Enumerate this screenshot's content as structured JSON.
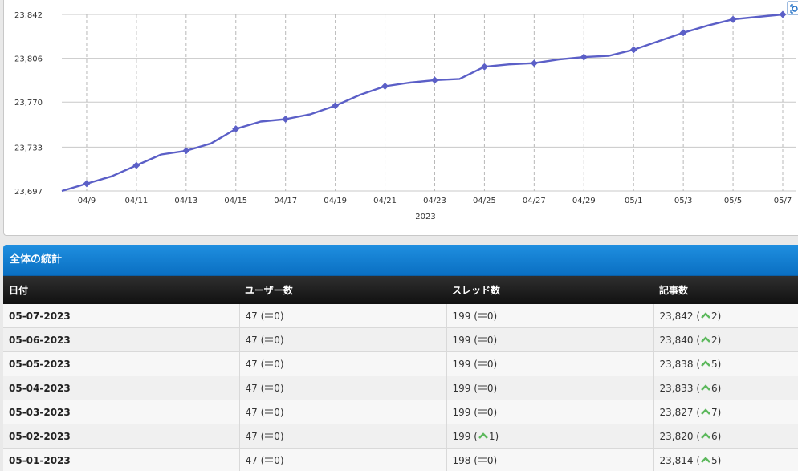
{
  "chart": {
    "zoom_icon": "zoom-reset-icon",
    "line_color": "#5b5fc7",
    "chart_data": {
      "type": "line",
      "x": [
        "2023-04-08",
        "2023-04-09",
        "2023-04-10",
        "2023-04-11",
        "2023-04-12",
        "2023-04-13",
        "2023-04-14",
        "2023-04-15",
        "2023-04-16",
        "2023-04-17",
        "2023-04-18",
        "2023-04-19",
        "2023-04-20",
        "2023-04-21",
        "2023-04-22",
        "2023-04-23",
        "2023-04-24",
        "2023-04-25",
        "2023-04-26",
        "2023-04-27",
        "2023-04-28",
        "2023-04-29",
        "2023-04-30",
        "2023-05-01",
        "2023-05-02",
        "2023-05-03",
        "2023-05-04",
        "2023-05-05",
        "2023-05-06",
        "2023-05-07"
      ],
      "values": [
        23697,
        23703,
        23709,
        23718,
        23727,
        23730,
        23736,
        23748,
        23754,
        23756,
        23760,
        23767,
        23776,
        23783,
        23786,
        23788,
        23789,
        23799,
        23801,
        23802,
        23805,
        23807,
        23808,
        23813,
        23820,
        23827,
        23833,
        23838,
        23840,
        23842
      ],
      "marker_x": [
        "2023-04-09",
        "2023-04-11",
        "2023-04-13",
        "2023-04-15",
        "2023-04-17",
        "2023-04-19",
        "2023-04-21",
        "2023-04-23",
        "2023-04-25",
        "2023-04-27",
        "2023-04-29",
        "2023-05-01",
        "2023-05-03",
        "2023-05-05",
        "2023-05-07"
      ],
      "yticks": [
        "23,697",
        "23,733",
        "23,770",
        "23,806",
        "23,842"
      ],
      "ytick_values": [
        23697,
        23733,
        23770,
        23806,
        23842
      ],
      "ylim": [
        23697,
        23842
      ],
      "xticks": [
        "04/9",
        "04/11",
        "04/13",
        "04/15",
        "04/17",
        "04/19",
        "04/21",
        "04/23",
        "04/25",
        "04/27",
        "04/29",
        "05/1",
        "05/3",
        "05/5",
        "05/7"
      ],
      "xlabel": "2023",
      "grid": true
    }
  },
  "stats": {
    "title": "全体の統計",
    "columns": [
      "日付",
      "ユーザー数",
      "スレッド数",
      "記事数"
    ],
    "rows": [
      {
        "date": "05-07-2023",
        "users": "47",
        "users_delta": "0",
        "users_trend": "same",
        "threads": "199",
        "threads_delta": "0",
        "threads_trend": "same",
        "posts": "23,842",
        "posts_delta": "2",
        "posts_trend": "up"
      },
      {
        "date": "05-06-2023",
        "users": "47",
        "users_delta": "0",
        "users_trend": "same",
        "threads": "199",
        "threads_delta": "0",
        "threads_trend": "same",
        "posts": "23,840",
        "posts_delta": "2",
        "posts_trend": "up"
      },
      {
        "date": "05-05-2023",
        "users": "47",
        "users_delta": "0",
        "users_trend": "same",
        "threads": "199",
        "threads_delta": "0",
        "threads_trend": "same",
        "posts": "23,838",
        "posts_delta": "5",
        "posts_trend": "up"
      },
      {
        "date": "05-04-2023",
        "users": "47",
        "users_delta": "0",
        "users_trend": "same",
        "threads": "199",
        "threads_delta": "0",
        "threads_trend": "same",
        "posts": "23,833",
        "posts_delta": "6",
        "posts_trend": "up"
      },
      {
        "date": "05-03-2023",
        "users": "47",
        "users_delta": "0",
        "users_trend": "same",
        "threads": "199",
        "threads_delta": "0",
        "threads_trend": "same",
        "posts": "23,827",
        "posts_delta": "7",
        "posts_trend": "up"
      },
      {
        "date": "05-02-2023",
        "users": "47",
        "users_delta": "0",
        "users_trend": "same",
        "threads": "199",
        "threads_delta": "1",
        "threads_trend": "up",
        "posts": "23,820",
        "posts_delta": "6",
        "posts_trend": "up"
      },
      {
        "date": "05-01-2023",
        "users": "47",
        "users_delta": "0",
        "users_trend": "same",
        "threads": "198",
        "threads_delta": "0",
        "threads_trend": "same",
        "posts": "23,814",
        "posts_delta": "5",
        "posts_trend": "up"
      }
    ],
    "trend_icons": {
      "same": "equal-icon",
      "up": "up-arrow-icon"
    },
    "up_color": "#5cb85c",
    "same_color": "#999999"
  }
}
